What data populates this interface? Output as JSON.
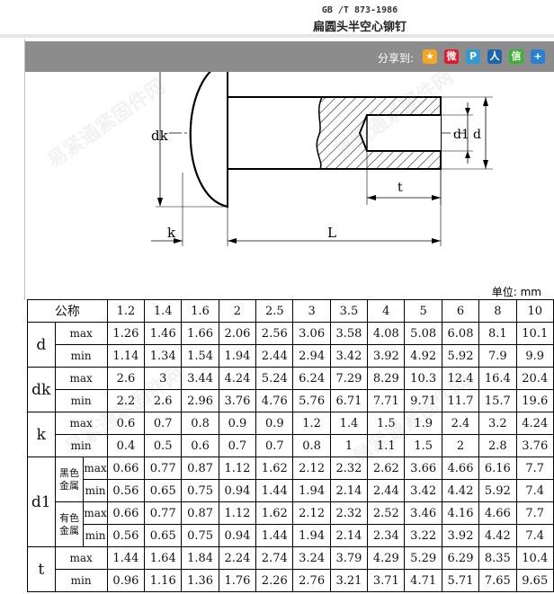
{
  "header": {
    "standard_code": "GB /T 873-1986",
    "title": "扁圆头半空心铆钉"
  },
  "share": {
    "label": "分享到:",
    "icons": [
      {
        "name": "qzone-star-icon",
        "glyph": "★",
        "color": "#f5a623"
      },
      {
        "name": "weibo-icon",
        "glyph": "微",
        "color": "#e6162d"
      },
      {
        "name": "tencent-weibo-icon",
        "glyph": "P",
        "color": "#2f9ad6"
      },
      {
        "name": "renren-icon",
        "glyph": "人",
        "color": "#1c65b0"
      },
      {
        "name": "wechat-icon",
        "glyph": "信",
        "color": "#3cb034"
      },
      {
        "name": "more-plus-icon",
        "glyph": "+",
        "color": "#2b7fd1"
      }
    ]
  },
  "diagram_labels": {
    "dk": "dk",
    "d1": "d1",
    "d": "d",
    "t": "t",
    "k": "k",
    "L": "L"
  },
  "unit_label": "单位: mm",
  "table": {
    "nominal_label": "公称",
    "sizes": [
      "1.2",
      "1.4",
      "1.6",
      "2",
      "2.5",
      "3",
      "3.5",
      "4",
      "5",
      "6",
      "8",
      "10"
    ],
    "d": {
      "label": "d",
      "max_label": "max",
      "min_label": "min",
      "max": [
        "1.26",
        "1.46",
        "1.66",
        "2.06",
        "2.56",
        "3.06",
        "3.58",
        "4.08",
        "5.08",
        "6.08",
        "8.1",
        "10.1"
      ],
      "min": [
        "1.14",
        "1.34",
        "1.54",
        "1.94",
        "2.44",
        "2.94",
        "3.42",
        "3.92",
        "4.92",
        "5.92",
        "7.9",
        "9.9"
      ]
    },
    "dk": {
      "label": "dk",
      "max_label": "max",
      "min_label": "min",
      "max": [
        "2.6",
        "3",
        "3.44",
        "4.24",
        "5.24",
        "6.24",
        "7.29",
        "8.29",
        "10.3",
        "12.4",
        "16.4",
        "20.4"
      ],
      "min": [
        "2.2",
        "2.6",
        "2.96",
        "3.76",
        "4.76",
        "5.76",
        "6.71",
        "7.71",
        "9.71",
        "11.7",
        "15.7",
        "19.6"
      ]
    },
    "k": {
      "label": "k",
      "max_label": "max",
      "min_label": "min",
      "max": [
        "0.6",
        "0.7",
        "0.8",
        "0.9",
        "0.9",
        "1.2",
        "1.4",
        "1.5",
        "1.9",
        "2.4",
        "3.2",
        "4.24"
      ],
      "min": [
        "0.4",
        "0.5",
        "0.6",
        "0.7",
        "0.7",
        "0.8",
        "1",
        "1.1",
        "1.5",
        "2",
        "2.8",
        "3.76"
      ]
    },
    "d1": {
      "label": "d1",
      "black_label": "黑色金属",
      "nonferrous_label": "有色金属",
      "max_label": "max",
      "min_label": "min",
      "black_max": [
        "0.66",
        "0.77",
        "0.87",
        "1.12",
        "1.62",
        "2.12",
        "2.32",
        "2.62",
        "3.66",
        "4.66",
        "6.16",
        "7.7"
      ],
      "black_min": [
        "0.56",
        "0.65",
        "0.75",
        "0.94",
        "1.44",
        "1.94",
        "2.14",
        "2.44",
        "3.42",
        "4.42",
        "5.92",
        "7.4"
      ],
      "nonferrous_max": [
        "0.66",
        "0.77",
        "0.87",
        "1.12",
        "1.62",
        "2.12",
        "2.32",
        "2.52",
        "3.46",
        "4.16",
        "4.66",
        "7.7"
      ],
      "nonferrous_min": [
        "0.56",
        "0.65",
        "0.75",
        "0.94",
        "1.44",
        "1.94",
        "2.14",
        "2.34",
        "3.22",
        "3.92",
        "4.42",
        "7.4"
      ]
    },
    "t": {
      "label": "t",
      "max_label": "max",
      "min_label": "min",
      "max": [
        "1.44",
        "1.64",
        "1.84",
        "2.24",
        "2.74",
        "3.24",
        "3.79",
        "4.29",
        "5.29",
        "6.29",
        "8.35",
        "10.4"
      ],
      "min": [
        "0.96",
        "1.16",
        "1.36",
        "1.76",
        "2.26",
        "2.76",
        "3.21",
        "3.71",
        "4.71",
        "5.71",
        "7.65",
        "9.65"
      ]
    }
  }
}
